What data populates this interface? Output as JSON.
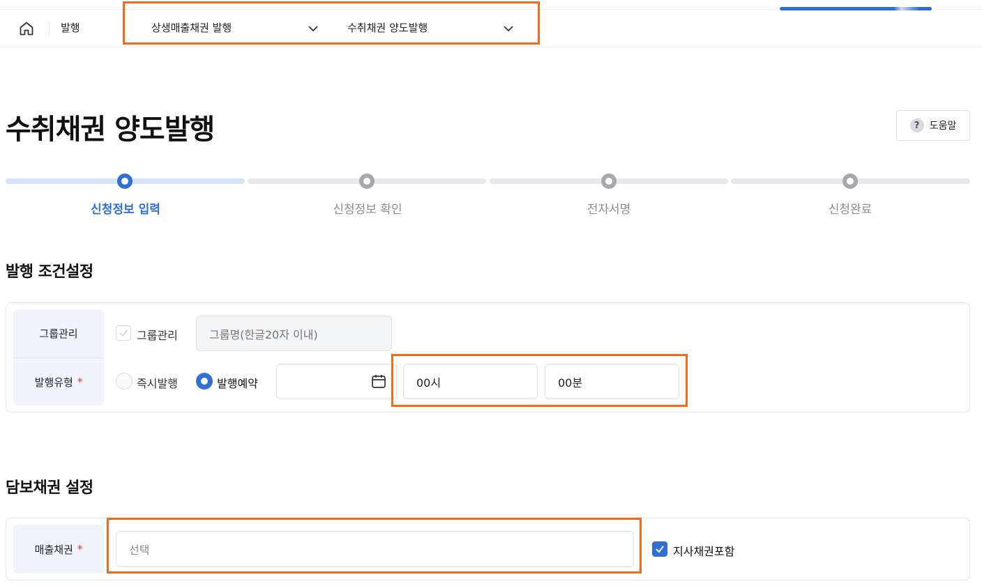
{
  "nav": {
    "root_label": "발행",
    "menu1": "상생매출채권 발행",
    "menu2": "수취채권 양도발행"
  },
  "page": {
    "title": "수취채권 양도발행",
    "help_label": "도움말",
    "help_icon": "question-mark-icon"
  },
  "steps": [
    {
      "label": "신청정보 입력",
      "active": true
    },
    {
      "label": "신청정보 확인",
      "active": false
    },
    {
      "label": "전자서명",
      "active": false
    },
    {
      "label": "신청완료",
      "active": false
    }
  ],
  "issue_conditions": {
    "section_title": "발행 조건설정",
    "group": {
      "label": "그룹관리",
      "checkbox_label": "그룹관리",
      "input_placeholder": "그룹명(한글20자 이내)"
    },
    "issue_type": {
      "label": "발행유형",
      "required_mark": "*",
      "option_immediate": "즉시발행",
      "option_reserved": "발행예약",
      "selected": "발행예약",
      "date_value": "",
      "hour_value": "00시",
      "minute_value": "00분"
    }
  },
  "collateral": {
    "section_title": "담보채권 설정",
    "sales_bond": {
      "label": "매출채권",
      "required_mark": "*",
      "select_placeholder": "선택",
      "include_branch_label": "지사채권포함",
      "include_branch_checked": true
    }
  },
  "colors": {
    "accent": "#2f6fd6",
    "highlight": "#f26a1b",
    "label_bg": "#f1f5fb",
    "required": "#e0362b"
  }
}
